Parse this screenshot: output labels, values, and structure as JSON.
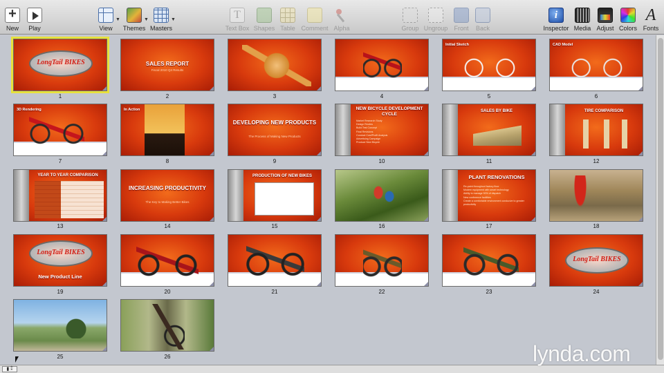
{
  "toolbar": {
    "new": "New",
    "play": "Play",
    "view": "View",
    "themes": "Themes",
    "masters": "Masters",
    "textbox": "Text Box",
    "shapes": "Shapes",
    "table": "Table",
    "comment": "Comment",
    "alpha": "Alpha",
    "group": "Group",
    "ungroup": "Ungroup",
    "front": "Front",
    "back": "Back",
    "inspector": "Inspector",
    "media": "Media",
    "adjust": "Adjust",
    "colors": "Colors",
    "fonts": "Fonts",
    "font_icon_glyph": "A"
  },
  "slides": [
    {
      "number": "1",
      "selected": true,
      "logo": "LongTail BIKES"
    },
    {
      "number": "2",
      "title": "SALES REPORT",
      "subtitle": "Fiscal 2010 Q4 Results"
    },
    {
      "number": "3"
    },
    {
      "number": "4"
    },
    {
      "number": "5",
      "label": "Initial Sketch"
    },
    {
      "number": "6",
      "label": "CAD Model"
    },
    {
      "number": "7",
      "label": "3D Rendering"
    },
    {
      "number": "8",
      "label": "In Action"
    },
    {
      "number": "9",
      "title": "DEVELOPING NEW PRODUCTS",
      "subtitle": "The Process of Making New Products"
    },
    {
      "number": "10",
      "title": "NEW BICYCLE DEVELOPMENT CYCLE",
      "bullets": [
        "Market Research Study",
        "Design Review",
        "Build Test Concept",
        "Final Revisions",
        "Conduct Cost/Profit Analysis",
        "Advertising Campaign",
        "Produce New Bicycle"
      ]
    },
    {
      "number": "11",
      "title": "SALES BY BIKE"
    },
    {
      "number": "12",
      "title": "TIRE COMPARISON"
    },
    {
      "number": "13",
      "title": "YEAR TO YEAR COMPARISON"
    },
    {
      "number": "14",
      "title": "INCREASING PRODUCTIVITY",
      "subtitle": "The Key to Making Better Bikes"
    },
    {
      "number": "15",
      "title": "PRODUCTION OF NEW BIKES"
    },
    {
      "number": "16"
    },
    {
      "number": "17",
      "title": "PLANT RENOVATIONS",
      "bullets": [
        "Re-paint throughout factory floor",
        "Modern equipment with smart technology",
        "Ability to manage 50% of dispatch",
        "New conference facilities",
        "Create a comfortable environment conducive to greater productivity"
      ]
    },
    {
      "number": "18"
    },
    {
      "number": "19",
      "logo": "LongTail BIKES",
      "overlay": "New Product Line"
    },
    {
      "number": "20"
    },
    {
      "number": "21"
    },
    {
      "number": "22"
    },
    {
      "number": "23"
    },
    {
      "number": "24",
      "logo": "LongTail BIKES"
    },
    {
      "number": "25"
    },
    {
      "number": "26"
    }
  ],
  "bottom_bar": {
    "button": "▮ ⁑"
  },
  "watermark": "lynda.com"
}
